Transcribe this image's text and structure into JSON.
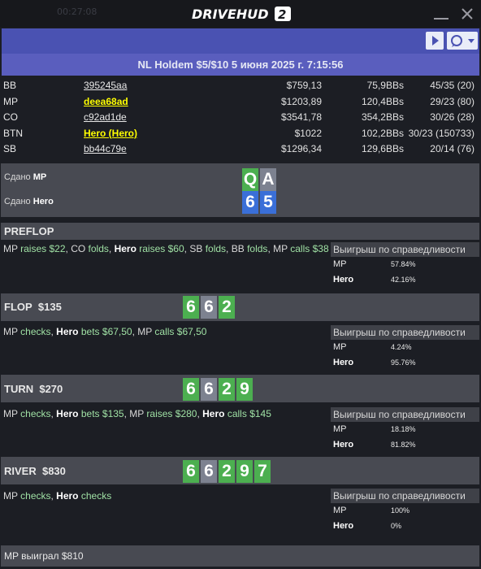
{
  "window": {
    "app_name": "DRIVEHUD",
    "app_version": "2",
    "background_text": "00:27:08"
  },
  "toolbar": {
    "icons": [
      "play-icon",
      "chat-icon",
      "caret-down-icon"
    ]
  },
  "hand": {
    "title": "NL Holdem $5/$10 5 июня 2025 г. 7:15:56"
  },
  "players": [
    {
      "position": "BB",
      "name": "395245aa",
      "stack": "$759,13",
      "bbs": "75,9BBs",
      "vpip": "45/35 (20)",
      "hero": false
    },
    {
      "position": "MP",
      "name": "deea68ad",
      "stack": "$1203,89",
      "bbs": "120,4BBs",
      "vpip": "29/23 (80)",
      "hero": true
    },
    {
      "position": "CO",
      "name": "c92ad1de",
      "stack": "$3541,78",
      "bbs": "354,2BBs",
      "vpip": "30/26 (28)",
      "hero": false
    },
    {
      "position": "BTN",
      "name": "Hero (Hero)",
      "stack": "$1022",
      "bbs": "102,2BBs",
      "vpip": "30/23 (150733)",
      "hero": true
    },
    {
      "position": "SB",
      "name": "bb44c79e",
      "stack": "$1296,34",
      "bbs": "129,6BBs",
      "vpip": "20/14 (76)",
      "hero": false
    }
  ],
  "dealt": {
    "label_prefix": "Сдано",
    "rows": [
      {
        "player": "MP",
        "cards": [
          {
            "rank": "Q",
            "suit": "h"
          },
          {
            "rank": "A",
            "suit": "s"
          }
        ]
      },
      {
        "player": "Hero",
        "cards": [
          {
            "rank": "6",
            "suit": "d"
          },
          {
            "rank": "5",
            "suit": "d"
          }
        ]
      }
    ]
  },
  "equity_label": "Выигрыш по справедливости",
  "streets": {
    "preflop": {
      "title": "PREFLOP",
      "actions": [
        {
          "p": "MP",
          "v": "raises",
          "a": "$22"
        },
        {
          "p": "CO",
          "v": "folds",
          "a": ""
        },
        {
          "p": "Hero",
          "v": "raises",
          "a": "$60"
        },
        {
          "p": "SB",
          "v": "folds",
          "a": ""
        },
        {
          "p": "BB",
          "v": "folds",
          "a": ""
        },
        {
          "p": "MP",
          "v": "calls",
          "a": "$38"
        }
      ],
      "equity": [
        {
          "name": "MP",
          "value": "57.84%"
        },
        {
          "name": "Hero",
          "value": "42.16%"
        }
      ]
    },
    "flop": {
      "title": "FLOP",
      "pot": "$135",
      "board": [
        {
          "rank": "6",
          "suit": "c"
        },
        {
          "rank": "6",
          "suit": "s"
        },
        {
          "rank": "2",
          "suit": "c"
        }
      ],
      "actions": [
        {
          "p": "MP",
          "v": "checks",
          "a": ""
        },
        {
          "p": "Hero",
          "v": "bets",
          "a": "$67,50"
        },
        {
          "p": "MP",
          "v": "calls",
          "a": "$67,50"
        }
      ],
      "equity": [
        {
          "name": "MP",
          "value": "4.24%"
        },
        {
          "name": "Hero",
          "value": "95.76%"
        }
      ]
    },
    "turn": {
      "title": "TURN",
      "pot": "$270",
      "board": [
        {
          "rank": "6",
          "suit": "c"
        },
        {
          "rank": "6",
          "suit": "s"
        },
        {
          "rank": "2",
          "suit": "c"
        },
        {
          "rank": "9",
          "suit": "c"
        }
      ],
      "actions": [
        {
          "p": "MP",
          "v": "checks",
          "a": ""
        },
        {
          "p": "Hero",
          "v": "bets",
          "a": "$135"
        },
        {
          "p": "MP",
          "v": "raises",
          "a": "$280"
        },
        {
          "p": "Hero",
          "v": "calls",
          "a": "$145"
        }
      ],
      "equity": [
        {
          "name": "MP",
          "value": "18.18%"
        },
        {
          "name": "Hero",
          "value": "81.82%"
        }
      ]
    },
    "river": {
      "title": "RIVER",
      "pot": "$830",
      "board": [
        {
          "rank": "6",
          "suit": "c"
        },
        {
          "rank": "6",
          "suit": "s"
        },
        {
          "rank": "2",
          "suit": "c"
        },
        {
          "rank": "9",
          "suit": "c"
        },
        {
          "rank": "7",
          "suit": "c"
        }
      ],
      "actions": [
        {
          "p": "MP",
          "v": "checks",
          "a": ""
        },
        {
          "p": "Hero",
          "v": "checks",
          "a": ""
        }
      ],
      "equity": [
        {
          "name": "MP",
          "value": "100%"
        },
        {
          "name": "Hero",
          "value": "0%"
        }
      ]
    }
  },
  "result": "MP выиграл $810",
  "colors": {
    "toolbar": "#4a52b2",
    "title_bar": "#5a5ebe",
    "section_bg": "#484a52",
    "hero_name": "#ffff00",
    "action_verb": "#9fe0a4",
    "card_green": "#4caf50",
    "card_blue": "#3a6fd8",
    "card_gray": "#7d8290"
  }
}
